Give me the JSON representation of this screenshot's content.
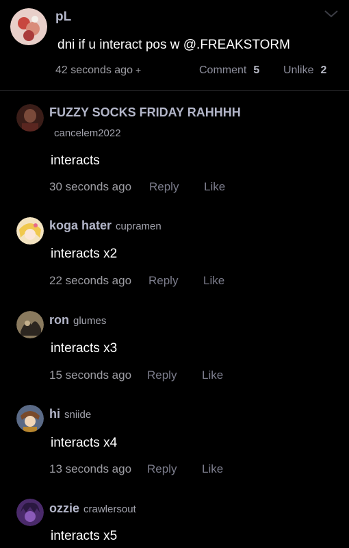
{
  "post": {
    "author": "pL",
    "text": "dni if u interact pos w @.FREAKSTORM",
    "time": "42 seconds ago",
    "plus": "+",
    "comment_label": "Comment",
    "comment_count": "5",
    "unlike_label": "Unlike",
    "like_count": "2",
    "avatar_icon": "avatar-icon",
    "menu_icon": "chevron-down-icon"
  },
  "comments": [
    {
      "display_name": "FUZZY SOCKS FRIDAY RAHHHH",
      "username": "cancelem2022",
      "text": "interacts",
      "time": "30 seconds ago",
      "reply": "Reply",
      "like": "Like"
    },
    {
      "display_name": "koga hater",
      "username": "cupramen",
      "text": "interacts x2",
      "time": "22 seconds ago",
      "reply": "Reply",
      "like": "Like"
    },
    {
      "display_name": "ron",
      "username": "glumes",
      "text": "interacts x3",
      "time": "15 seconds ago",
      "reply": "Reply",
      "like": "Like"
    },
    {
      "display_name": "hi",
      "username": "sniide",
      "text": "interacts x4",
      "time": "13 seconds ago",
      "reply": "Reply",
      "like": "Like"
    },
    {
      "display_name": "ozzie",
      "username": "crawlersout",
      "text": "interacts x5"
    }
  ],
  "colors": {
    "background": "#000000",
    "name": "#b3b6c9",
    "secondary": "#9d9da3",
    "action": "#7c7d8c",
    "divider": "#2a2a2c"
  }
}
